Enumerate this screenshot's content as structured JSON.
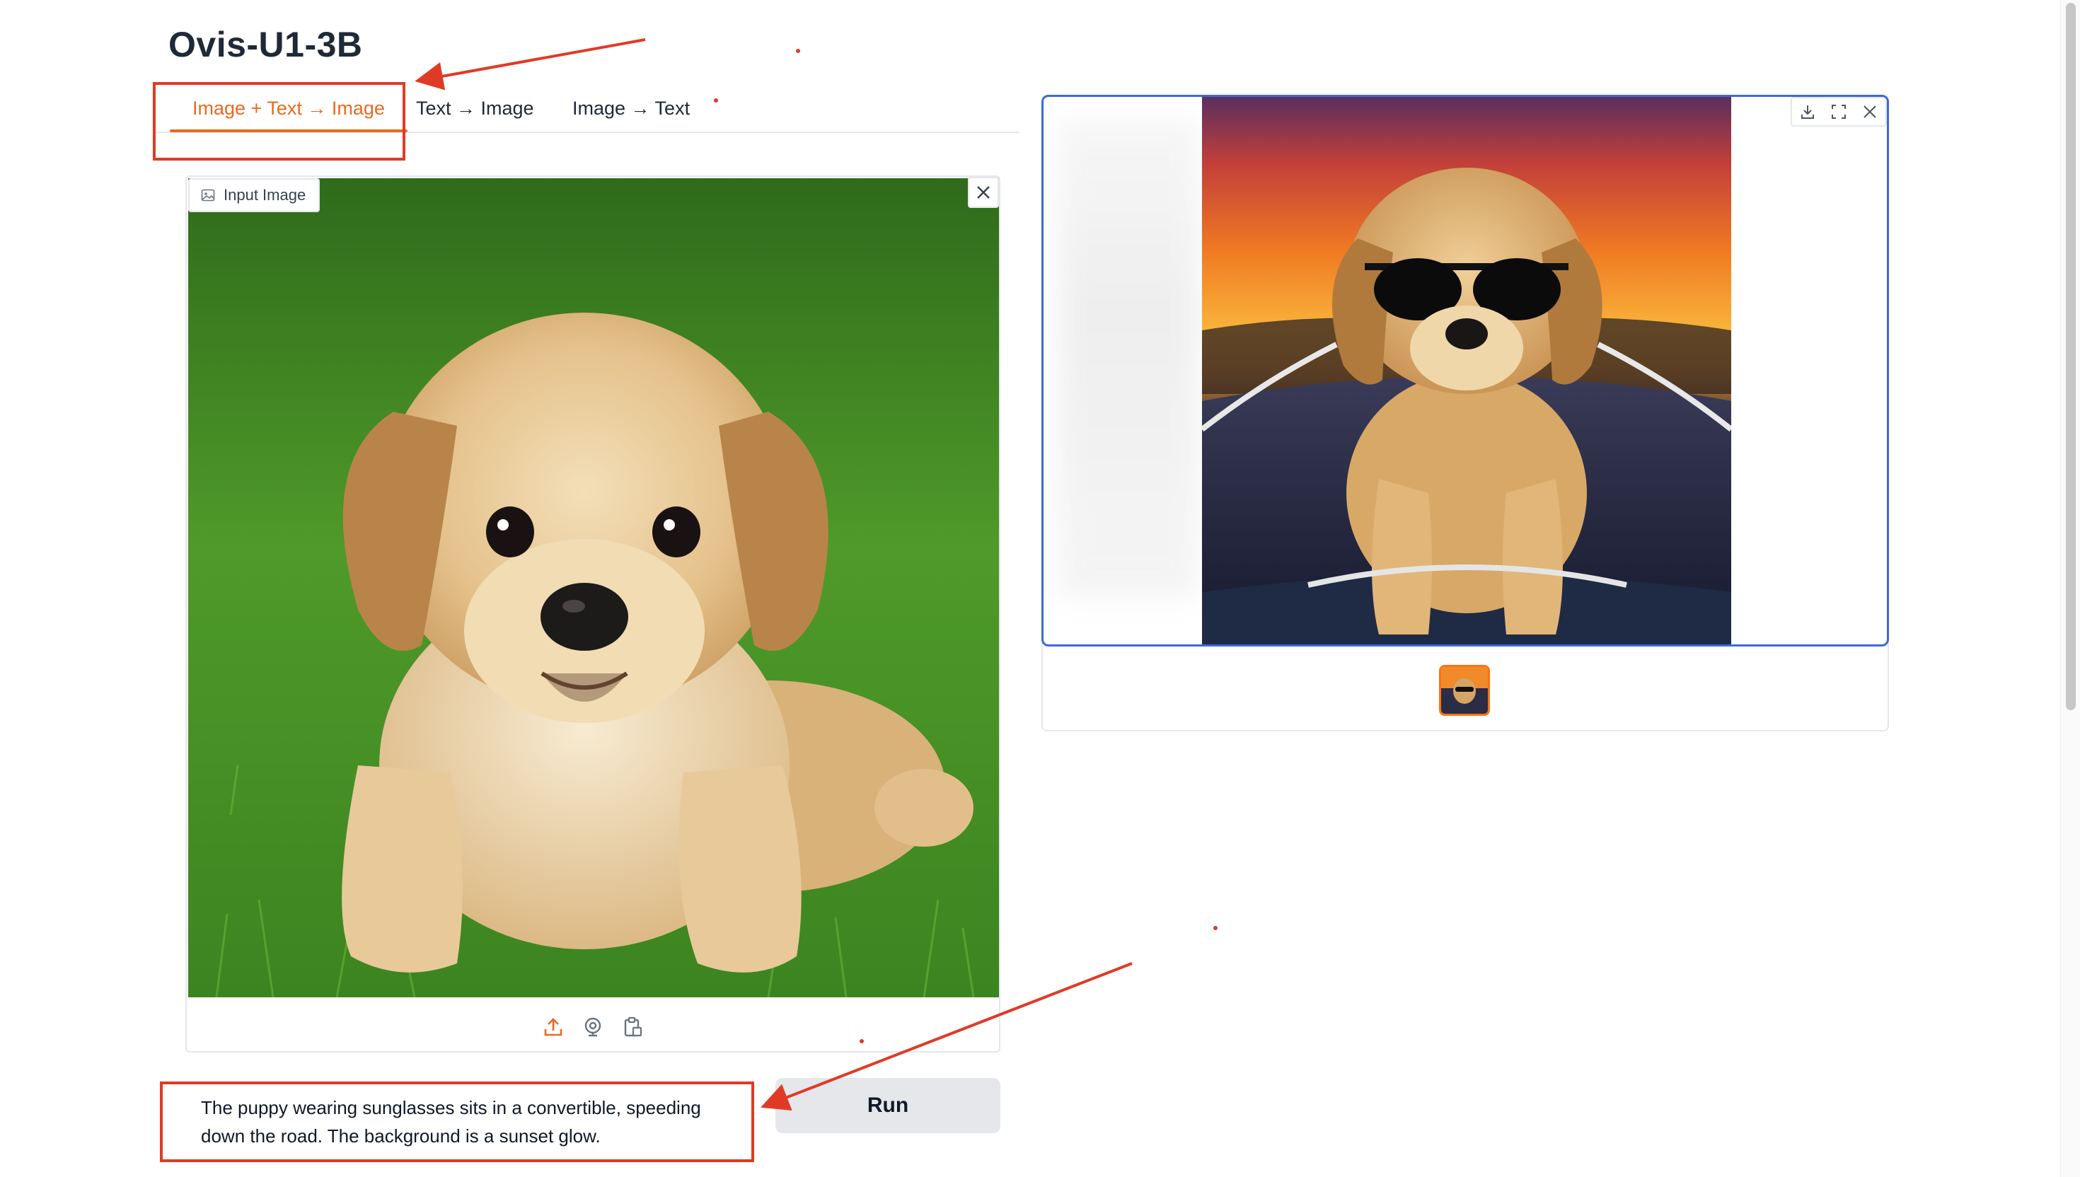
{
  "app": {
    "title": "Ovis-U1-3B"
  },
  "tabs": [
    {
      "label": "Image + Text → Image",
      "active": true
    },
    {
      "label": "Text → Image",
      "active": false
    },
    {
      "label": "Image → Text",
      "active": false
    }
  ],
  "input_panel": {
    "label": "Input Image",
    "image_icon": "image-icon",
    "close_icon": "close-icon",
    "toolbar": [
      "upload-icon",
      "webcam-icon",
      "clipboard-icon"
    ]
  },
  "prompt": {
    "value": "The puppy wearing sunglasses sits in a convertible, speeding down the road. The background is a sunset glow."
  },
  "run_button": {
    "label": "Run"
  },
  "output_gallery": {
    "toolbar": [
      "download-icon",
      "fullscreen-icon",
      "close-icon"
    ],
    "thumbnails": 1
  },
  "colors": {
    "accent": "#ea6a1f",
    "annotation": "#e03a26",
    "output_border": "#3b6bd9",
    "run_button_bg": "#e5e7eb"
  }
}
